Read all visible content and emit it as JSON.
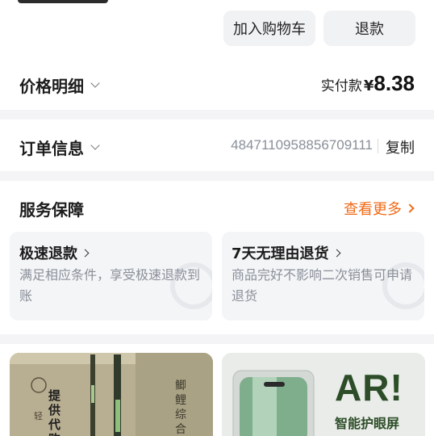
{
  "actions": {
    "add_to_cart": "加入购物车",
    "refund": "退款"
  },
  "price_detail": {
    "title": "价格明细",
    "paid_label": "实付款",
    "currency": "¥",
    "amount": "8.38"
  },
  "order_info": {
    "title": "订单信息",
    "order_number": "4847110958856709111",
    "copy": "复制"
  },
  "service": {
    "title": "服务保障",
    "more": "查看更多",
    "items": [
      {
        "title": "极速退款",
        "desc": "满足相应条件，享受极速退款到账"
      },
      {
        "title": "7天无理由退货",
        "desc": "商品完好不影响二次销售可申请退货"
      }
    ]
  },
  "products": {
    "left": {
      "vertical_text_1": "提供代购",
      "vertical_text_2": "鲫鲤综合",
      "seal_text": "轻"
    },
    "right": {
      "big_text": "AR!",
      "sub_text": "智能护眼屏"
    }
  },
  "colors": {
    "accent": "#f06a17",
    "muted": "#8a8f99"
  }
}
